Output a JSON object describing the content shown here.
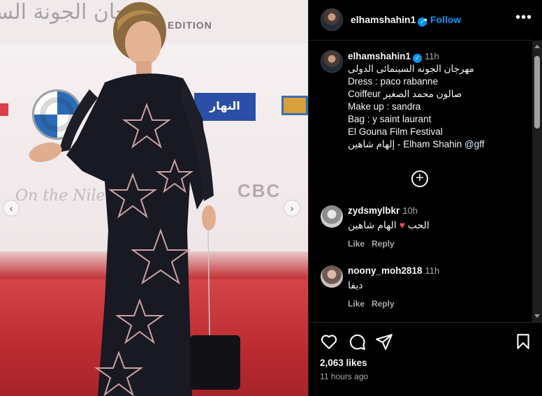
{
  "photo": {
    "banner_title_arabic": "مهرجان الجونة السينمائي",
    "banner_edition": "EDITION",
    "sponsor_text": "النهار",
    "script_text": "On the Nile",
    "cbc_text": "CBC",
    "carousel_prev": "‹",
    "carousel_next": "›"
  },
  "header": {
    "username": "elhamshahin1",
    "dot": "•",
    "follow_label": "Follow",
    "more_label": "•••"
  },
  "caption": {
    "username": "elhamshahin1",
    "time": "11h",
    "lines": [
      "مهرجان الجونه السينمائى الدولى",
      "Dress : paco rabanne",
      "Coiffeur صالون محمد الصغير",
      "Make up : sandra",
      "Bag : y saint laurant",
      "El Gouna Film Festival"
    ],
    "last_line_text": "إلهام شاهين - Elham Shahin ",
    "last_line_link": "@gff"
  },
  "load_more_icon": "+",
  "comments": [
    {
      "username": "zydsmylbkr",
      "time": "10h",
      "text_before": "الهام شاهين",
      "heart": "♥",
      "text_after": "الحب",
      "like_label": "Like",
      "reply_label": "Reply"
    },
    {
      "username": "noony_moh2818",
      "time": "11h",
      "text": "ديفا",
      "like_label": "Like",
      "reply_label": "Reply"
    }
  ],
  "footer": {
    "likes": "2,063 likes",
    "time_ago": "11 hours ago"
  },
  "colors": {
    "accent_blue": "#0095f6",
    "heart_red": "#ed4956",
    "background": "#000000",
    "muted_text": "#a8a8a8"
  },
  "icons": [
    "heart-icon",
    "comment-icon",
    "share-icon",
    "bookmark-icon",
    "verified-icon",
    "plus-circle-icon",
    "more-icon"
  ]
}
